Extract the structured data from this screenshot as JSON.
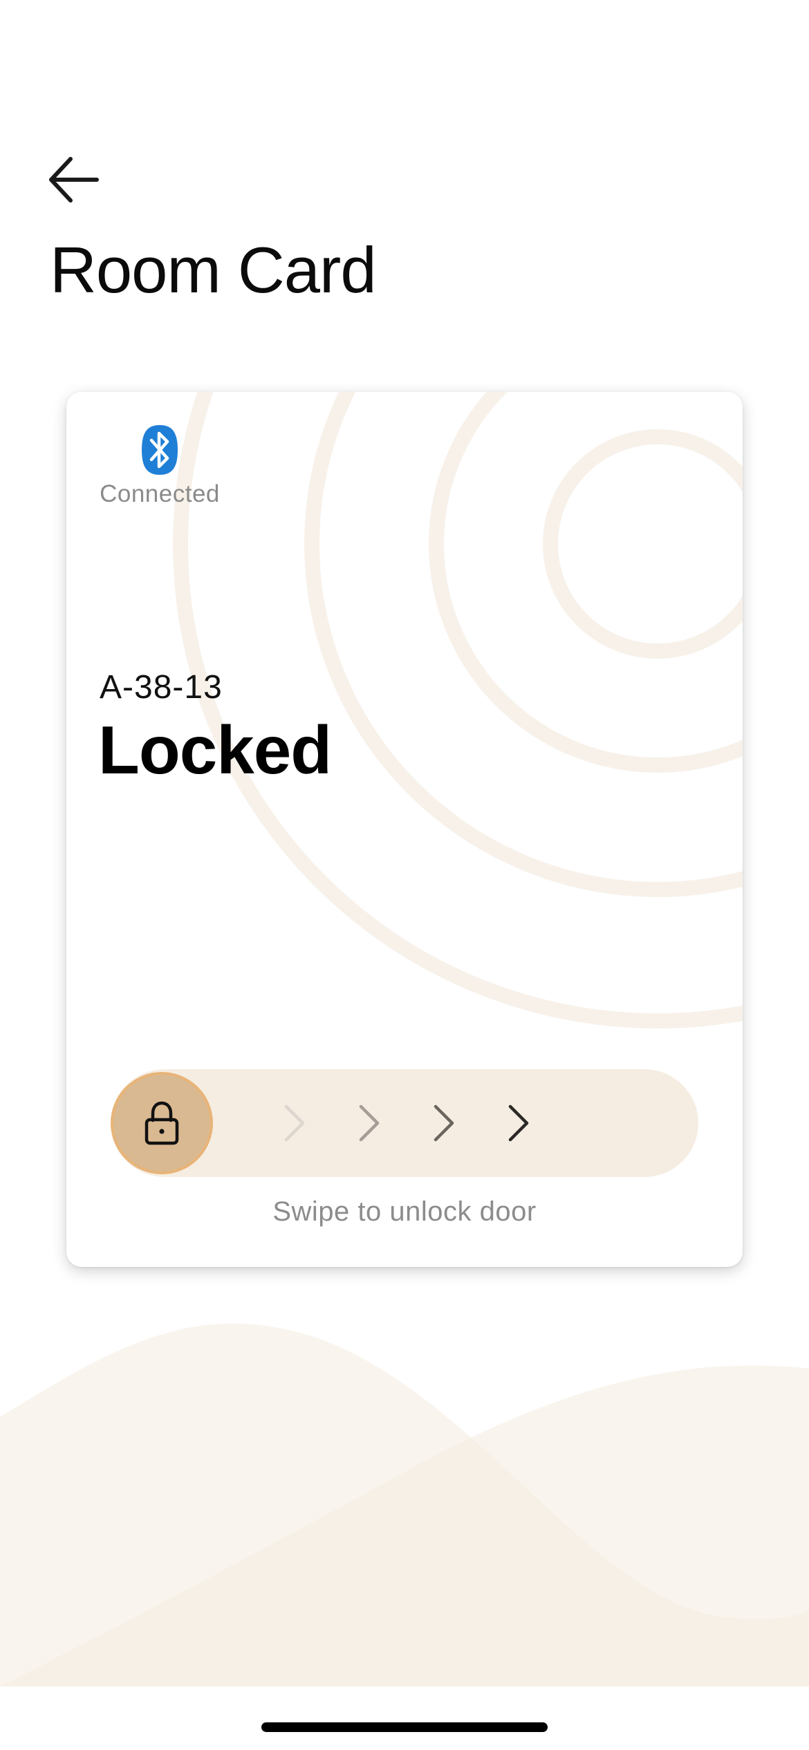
{
  "header": {
    "back_icon": "arrow-left-icon",
    "title": "Room Card"
  },
  "card": {
    "bluetooth": {
      "icon": "bluetooth-icon",
      "status": "Connected",
      "color": "#1f7fd6"
    },
    "room_number": "A-38-13",
    "lock_status": "Locked",
    "slider": {
      "knob_icon": "lock-icon",
      "hint": "Swipe to unlock door",
      "progress": 0,
      "chevron_count": 4
    }
  },
  "colors": {
    "accent": "#d9b991",
    "accent_border": "#e8b478",
    "track": "#f5ede2",
    "decor": "#f7f1ea"
  }
}
